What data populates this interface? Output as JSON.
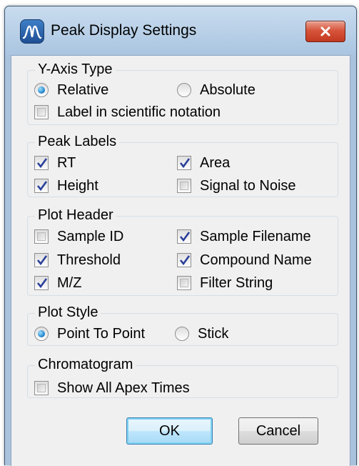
{
  "window": {
    "title": "Peak Display Settings"
  },
  "groups": {
    "y_axis": {
      "title": "Y-Axis Type",
      "relative": {
        "label": "Relative",
        "selected": true
      },
      "absolute": {
        "label": "Absolute",
        "selected": false
      },
      "scientific": {
        "label": "Label in scientific notation",
        "checked": false
      }
    },
    "peak_labels": {
      "title": "Peak Labels",
      "rt": {
        "label": "RT",
        "checked": true
      },
      "area": {
        "label": "Area",
        "checked": true
      },
      "height": {
        "label": "Height",
        "checked": true
      },
      "signal_to_noise": {
        "label": "Signal to Noise",
        "checked": false
      }
    },
    "plot_header": {
      "title": "Plot Header",
      "sample_id": {
        "label": "Sample ID",
        "checked": false
      },
      "sample_filename": {
        "label": "Sample Filename",
        "checked": true
      },
      "threshold": {
        "label": "Threshold",
        "checked": true
      },
      "compound_name": {
        "label": "Compound Name",
        "checked": true
      },
      "mz": {
        "label": "M/Z",
        "checked": true
      },
      "filter_string": {
        "label": "Filter String",
        "checked": false
      }
    },
    "plot_style": {
      "title": "Plot Style",
      "point_to_point": {
        "label": "Point To Point",
        "selected": true
      },
      "stick": {
        "label": "Stick",
        "selected": false
      }
    },
    "chromatogram": {
      "title": "Chromatogram",
      "show_all_apex": {
        "label": "Show All Apex Times",
        "checked": false
      }
    }
  },
  "buttons": {
    "ok": "OK",
    "cancel": "Cancel"
  },
  "icons": {
    "app": "peak-waveform-icon",
    "close": "close-x-icon",
    "check": "checkmark-icon"
  },
  "colors": {
    "titlebar": "#aac5e1",
    "close_button": "#c9432a",
    "client_bg": "#f0f0f0",
    "radio_dot": "#1c7fc8",
    "check_mark": "#2a3f9a"
  }
}
